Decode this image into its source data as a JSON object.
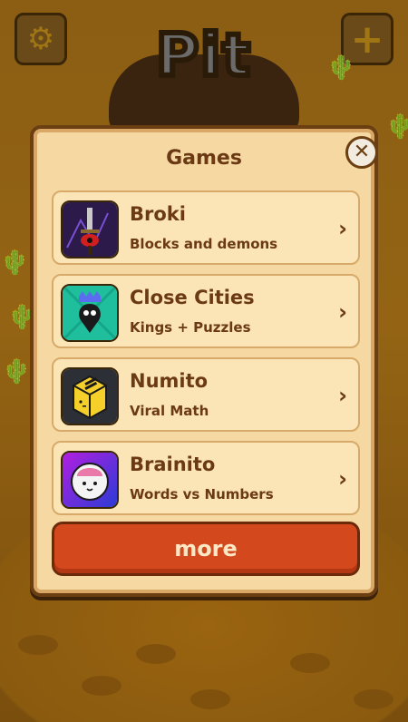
{
  "background": {
    "settings_icon": "gear-icon",
    "add_icon": "plus-icon",
    "logo_text": "Pit"
  },
  "dialog": {
    "title": "Games",
    "close_icon": "close-icon",
    "games": [
      {
        "name": "Broki",
        "subtitle": "Blocks and demons",
        "icon": "sword-eye-icon"
      },
      {
        "name": "Close Cities",
        "subtitle": "Kings + Puzzles",
        "icon": "crowned-pin-icon"
      },
      {
        "name": "Numito",
        "subtitle": "Viral Math",
        "icon": "yellow-cube-icon"
      },
      {
        "name": "Brainito",
        "subtitle": "Words vs Numbers",
        "icon": "brain-cat-icon"
      }
    ],
    "more_label": "more"
  },
  "colors": {
    "panel": "#f6d9a2",
    "card": "#fbe4b6",
    "text_brown": "#6b3a14",
    "more_button": "#d4481e"
  }
}
